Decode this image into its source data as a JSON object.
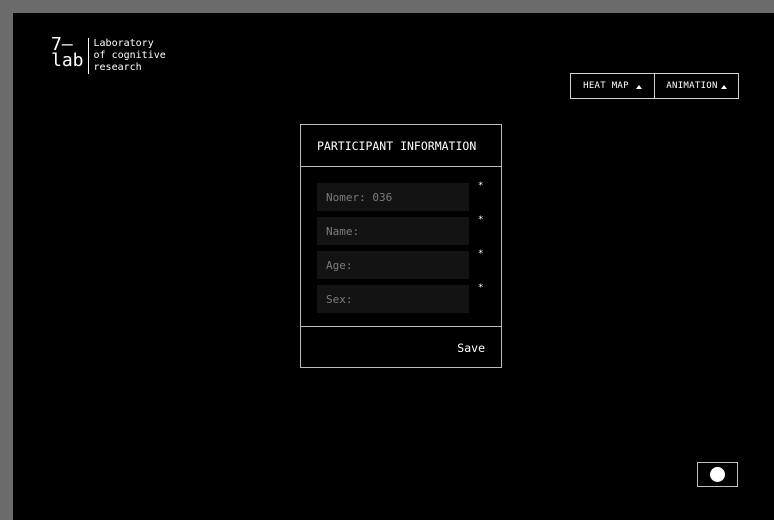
{
  "logo": {
    "mark_top": "7—",
    "mark_bottom": "lab",
    "text_lines": [
      "Laboratory",
      "of cognitive",
      "research"
    ]
  },
  "toolbar": {
    "heat_map_label": "HEAT MAP",
    "animation_label": "ANIMATION"
  },
  "form": {
    "title": "PARTICIPANT INFORMATION",
    "fields": [
      {
        "placeholder": "Nomer: 036",
        "required_mark": "*"
      },
      {
        "placeholder": "Name:",
        "required_mark": "*"
      },
      {
        "placeholder": "Age:",
        "required_mark": "*"
      },
      {
        "placeholder": "Sex:",
        "required_mark": "*"
      }
    ],
    "save_label": "Save"
  },
  "colors": {
    "background": "#000000",
    "frame": "#6b6b6b",
    "field_background": "#131313",
    "border": "#bdbdbd"
  },
  "icons": {
    "heat_map_toggle": "triangle-up-icon",
    "animation_toggle": "triangle-up-icon",
    "record": "record-dot-icon"
  }
}
